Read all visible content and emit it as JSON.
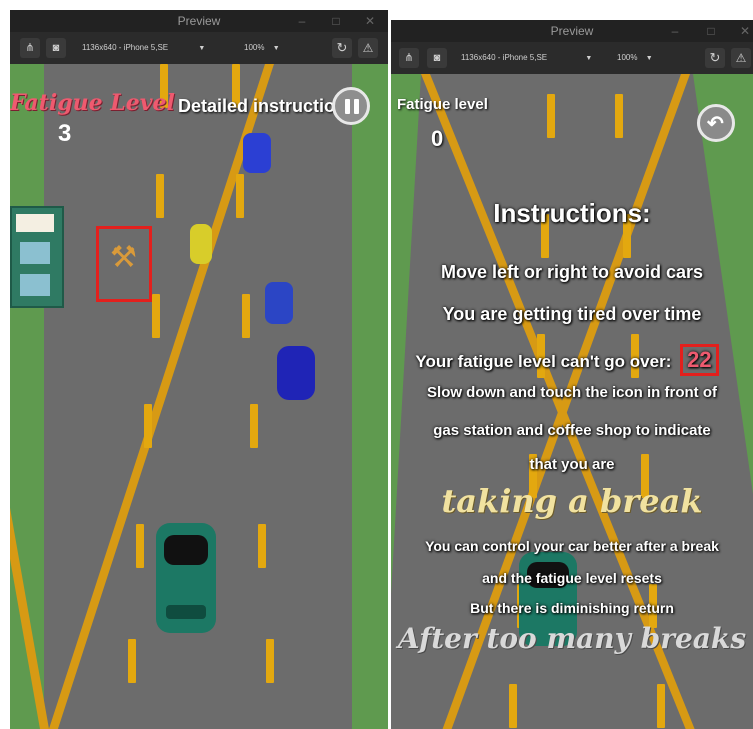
{
  "left_window": {
    "title": "Preview",
    "toolbar": {
      "device": "1136x640 - iPhone 5,SE",
      "zoom": "100%"
    },
    "hud": {
      "fatigue_label": "Fatigue Level",
      "fatigue_value": "3",
      "instruction_label": "Detailed instruction:"
    }
  },
  "right_window": {
    "title": "Preview",
    "toolbar": {
      "device": "1136x640 - iPhone 5,SE",
      "zoom": "100%"
    },
    "hud": {
      "fatigue_label": "Fatigue level",
      "fatigue_value": "0"
    },
    "instructions": {
      "heading": "Instructions:",
      "line1": "Move left or right  to avoid cars",
      "line2": "You are getting tired over time",
      "line3": "Your fatigue level can't go over:",
      "max_value": "22",
      "line4": "Slow down and touch the icon in front of",
      "line5": "gas station and coffee shop to indicate",
      "line6": "that you are",
      "highlight1": "taking a break",
      "line7": "You can control your car better after a break",
      "line8": "and the fatigue level resets",
      "line9": "But there is diminishing return",
      "highlight2": "After too many breaks"
    }
  },
  "colors": {
    "grass": "#5f9a4f",
    "road": "#6c6c6c",
    "lane": "#e3a80f",
    "highlight_red": "#e3201d",
    "fatigue_pink": "#ee5a6f",
    "gold": "#f1e2a0"
  }
}
